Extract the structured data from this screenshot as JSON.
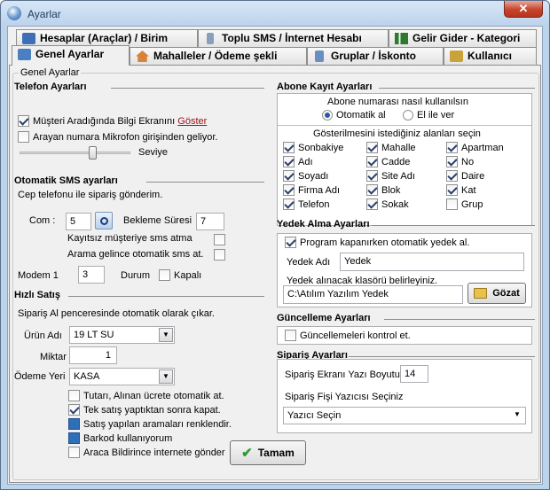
{
  "window": {
    "title": "Ayarlar",
    "close": "✕"
  },
  "tabs_row1": [
    "Hesaplar (Araçlar) / Birim",
    "Toplu SMS / İnternet Hesabı",
    "Gelir Gider - Kategori"
  ],
  "tabs_row2": [
    "Genel Ayarlar",
    "Mahalleler / Ödeme şekli",
    "Gruplar / İskonto",
    "Kullanıcı"
  ],
  "group_title": "Genel Ayarlar",
  "telefon": {
    "title": "Telefon Ayarları",
    "cb1": "Müşteri Aradığında Bilgi Ekranını",
    "cb1_link": "Göster",
    "cb2": "Arayan numara Mikrofon girişinden geliyor.",
    "seviye": "Seviye"
  },
  "sms": {
    "title": "Otomatik SMS ayarları",
    "desc": "Cep telefonu ile sipariş gönderim.",
    "com_label": "Com :",
    "com_value": "5",
    "bekleme_label": "Bekleme Süresi",
    "bekleme_value": "7",
    "kayitsiz": "Kayıtsız müşteriye sms atma",
    "arama": "Arama gelince otomatik sms at.",
    "modem_label": "Modem 1",
    "modem_value": "3",
    "durum": "Durum",
    "kapali": "Kapalı"
  },
  "hizli": {
    "title": "Hızlı Satış",
    "desc": "Sipariş Al penceresinde otomatik olarak çıkar.",
    "urun_label": "Ürün Adı",
    "urun_value": "19 LT SU",
    "miktar_label": "Miktar",
    "miktar_value": "1",
    "odeme_label": "Ödeme Yeri",
    "odeme_value": "KASA",
    "cb1": "Tutarı, Alınan ücrete otomatik at.",
    "cb2": "Tek satış yaptıktan sonra kapat.",
    "cb3": "Satış yapılan aramaları renklendir.",
    "cb4": "Barkod kullanıyorum",
    "cb5": "Araca Bildirince internete gönder"
  },
  "abone": {
    "title": "Abone Kayıt Ayarları",
    "q": "Abone numarası nasıl kullanılsın",
    "r1": "Otomatik al",
    "r2": "El ile ver",
    "fields_title": "Gösterilmesini istediğiniz alanları seçin",
    "fields": [
      {
        "l": "Sonbakiye",
        "c": true
      },
      {
        "l": "Mahalle",
        "c": true
      },
      {
        "l": "Apartman",
        "c": true
      },
      {
        "l": "Adı",
        "c": true
      },
      {
        "l": "Cadde",
        "c": true
      },
      {
        "l": "No",
        "c": true
      },
      {
        "l": "Soyadı",
        "c": true
      },
      {
        "l": "Site Adı",
        "c": true
      },
      {
        "l": "Daire",
        "c": true
      },
      {
        "l": "Firma Adı",
        "c": true
      },
      {
        "l": "Blok",
        "c": true
      },
      {
        "l": "Kat",
        "c": true
      },
      {
        "l": "Telefon",
        "c": true
      },
      {
        "l": "Sokak",
        "c": true
      },
      {
        "l": "Grup",
        "c": false
      }
    ]
  },
  "yedek": {
    "title": "Yedek Alma Ayarları",
    "cb": "Program kapanırken otomatik yedek al.",
    "adi_label": "Yedek Adı",
    "adi_value": "Yedek",
    "klasor_label": "Yedek alınacak klasörü belirleyiniz.",
    "klasor_value": "C:\\Atılım Yazılım Yedek",
    "gozat": "Gözat"
  },
  "guncelleme": {
    "title": "Güncelleme Ayarları",
    "cb": "Güncellemeleri kontrol et."
  },
  "siparis": {
    "title": "Sipariş Ayarları",
    "yazi_label": "Sipariş Ekranı Yazı Boyutu",
    "yazi_value": "14",
    "yazici_label": "Sipariş Fişi Yazıcısı Seçiniz",
    "yazici_value": "Yazıcı Seçin"
  },
  "tamam": "Tamam"
}
